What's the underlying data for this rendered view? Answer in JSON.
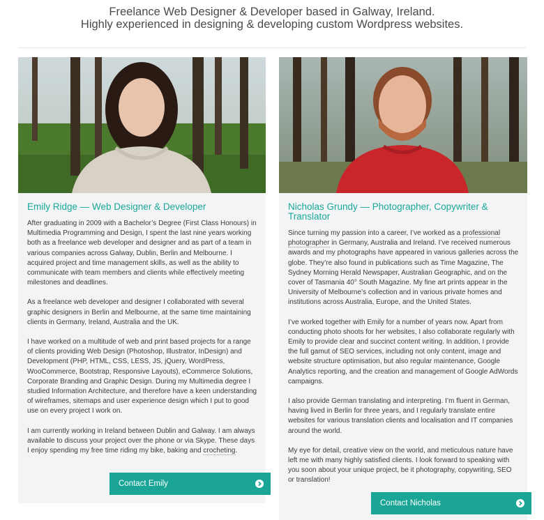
{
  "intro": {
    "line1": "Freelance Web Designer & Developer based in Galway, Ireland.",
    "line2": "Highly experienced in designing & developing custom Wordpress websites."
  },
  "people": [
    {
      "heading": "Emily Ridge — Web Designer & Developer",
      "paragraphs": [
        "After graduating in 2009 with a Bachelor’s Degree (First Class Honours) in Multimedia Programming and Design, I spent the last nine years working both as a freelance web developer and designer and as part of a team in various companies across Galway, Dublin, Berlin and Melbourne. I acquired project and time management skills, as well as the ability to communicate with team members and clients while effectively meeting milestones and deadlines.",
        "As a freelance web developer and designer I collaborated with several graphic designers in Berlin and Melbourne, at the same time maintaining clients in Germany, Ireland, Australia and the UK.",
        "I have worked on a multitude of web and print based projects for a range of clients providing Web Design (Photoshop, Illustrator, InDesign) and Development (PHP, HTML, CSS, LESS, JS, jQuery, WordPress, WooCommerce, Bootstrap, Responsive Layouts), eCommerce Solutions, Corporate Branding and Graphic Design. During my Multimedia degree I studied Information Architecture, and therefore have a keen understanding of wireframes, sitemaps and user experience design which I put to good use on every project I work on.",
        "I am currently working in Ireland between Dublin and Galway. I am always available to discuss your project over the phone or via Skype. These days I enjoy spending my free time riding my bike, baking and ",
        "crocheting",
        "."
      ],
      "button": "Contact Emily"
    },
    {
      "heading": "Nicholas Grundy — Photographer, Copywriter & Translator",
      "p1_before": "Since turning my passion into a career, I’ve worked as a ",
      "p1_link": "professional photographer",
      "p1_after": " in Germany, Australia and Ireland. I’ve received numerous awards and my photographs have appeared in various galleries across the globe. They’re also found in publications such as Time Magazine, The Sydney Morning Herald Newspaper, Australian Geographic, and on the cover of Tasmania 40° South Magazine. My fine art prints appear in the University of Melbourne’s collection and in various private homes and institutions across Australia, Europe, and the United States.",
      "p2": "I’ve worked together with Emily for a number of years now. Apart from conducting photo shoots for her websites, I also collaborate regularly with Emily to provide clear and succinct content writing. In addition, I provide the full gamut of SEO services, including not only content, image and website structure optimisation, but also regular maintenance, Google Analytics reporting, and the creation and management of Google AdWords campaigns.",
      "p3": "I also provide German translating and interpreting. I’m fluent in German, having lived in Berlin for three years, and I regularly translate entire websites for various translation clients and localisation and IT companies around the world.",
      "p4": "My eye for detail, creative view on the world, and meticulous nature have left me with many highly satisfied clients. I look forward to speaking with you soon about your unique project, be it photography, copywriting, SEO or translation!",
      "button": "Contact Nicholas"
    }
  ]
}
